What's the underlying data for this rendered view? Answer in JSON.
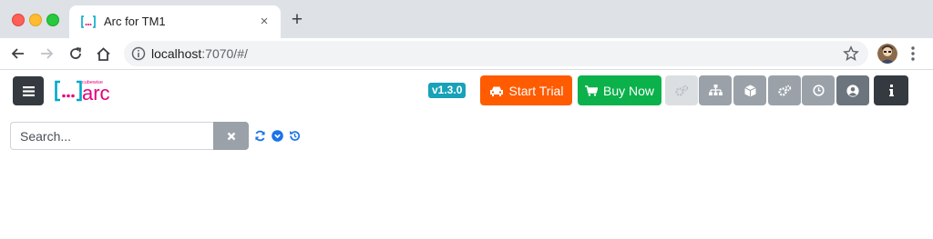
{
  "browser": {
    "tab_title": "Arc for TM1",
    "url_host": "localhost",
    "url_rest": ":7070/#/"
  },
  "app": {
    "logo_small": "cubewise",
    "logo_main": "arc",
    "version": "v1.3.0",
    "start_trial_label": "Start Trial",
    "buy_now_label": "Buy Now",
    "search_placeholder": "Search..."
  },
  "colors": {
    "version_badge": "#17a2b8",
    "start_trial": "#ff5b00",
    "buy_now": "#0bb14a",
    "dark": "#343a40",
    "secondary": "#6c757d",
    "logo_accent": "#e5007e",
    "logo_bracket": "#00a9c9",
    "link_blue": "#1a73e8"
  }
}
